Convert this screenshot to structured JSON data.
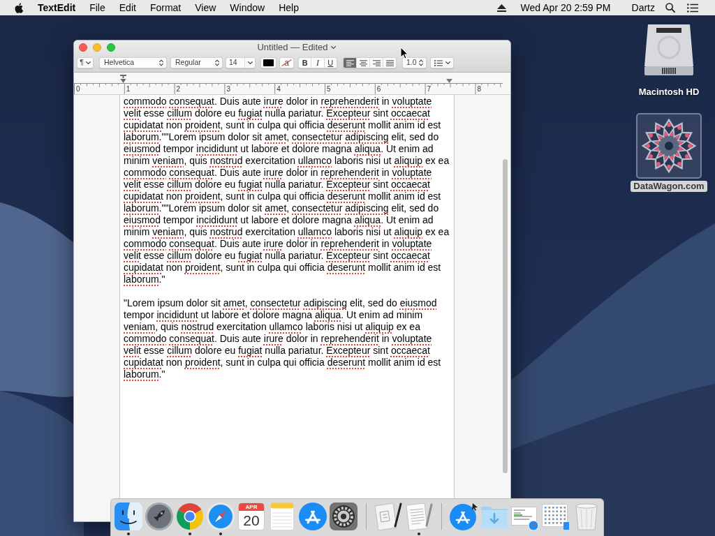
{
  "menu_bar": {
    "app_name": "TextEdit",
    "menus": [
      "File",
      "Edit",
      "Format",
      "View",
      "Window",
      "Help"
    ],
    "clock": "Wed Apr 20 2:59 PM",
    "user": "Dartz"
  },
  "window": {
    "title": "Untitled — Edited",
    "toolbar": {
      "paragraph_style": "¶",
      "font_family": "Helvetica",
      "typeface": "Regular",
      "font_size": "14",
      "background_color_glyph": "a",
      "styles": [
        {
          "kind": "bold",
          "label": "B",
          "selected": false
        },
        {
          "kind": "italic",
          "label": "I",
          "selected": false
        },
        {
          "kind": "underline",
          "label": "U",
          "selected": false
        }
      ],
      "alignments": [
        {
          "kind": "left",
          "selected": true
        },
        {
          "kind": "center",
          "selected": false
        },
        {
          "kind": "right",
          "selected": false
        },
        {
          "kind": "justify",
          "selected": false
        }
      ],
      "line_spacing": "1.0"
    },
    "ruler": {
      "labels": [
        "0",
        "1",
        "2",
        "3",
        "4",
        "5",
        "6",
        "7",
        "8"
      ]
    },
    "document": {
      "paragraphs": [
        {
          "lines": [
            [
              {
                "text": "commodo",
                "misspelled": true
              },
              {
                "text": " consequat",
                "misspelled": true
              },
              {
                "text": ". Duis aute ",
                "misspelled": false
              },
              {
                "text": "irure",
                "misspelled": true
              },
              {
                "text": " dolor in ",
                "misspelled": false
              },
              {
                "text": "reprehenderit",
                "misspelled": true
              },
              {
                "text": " in ",
                "misspelled": false
              },
              {
                "text": "voluptate",
                "misspelled": true
              }
            ],
            [
              {
                "text": "velit",
                "misspelled": true
              },
              {
                "text": " esse ",
                "misspelled": false
              },
              {
                "text": "cillum",
                "misspelled": true
              },
              {
                "text": " dolore eu ",
                "misspelled": false
              },
              {
                "text": "fugiat",
                "misspelled": true
              },
              {
                "text": " nulla pariatur. ",
                "misspelled": false
              },
              {
                "text": "Excepteur",
                "misspelled": true
              },
              {
                "text": " sint ",
                "misspelled": false
              },
              {
                "text": "occaecat",
                "misspelled": true
              }
            ],
            [
              {
                "text": "cupidatat",
                "misspelled": true
              },
              {
                "text": " non ",
                "misspelled": false
              },
              {
                "text": "proident",
                "misspelled": true
              },
              {
                "text": ", sunt in culpa qui officia ",
                "misspelled": false
              },
              {
                "text": "deserunt",
                "misspelled": true
              },
              {
                "text": " mollit anim id est",
                "misspelled": false
              }
            ],
            [
              {
                "text": "laborum",
                "misspelled": true
              },
              {
                "text": ".\"\"Lorem ipsum dolor sit ",
                "misspelled": false
              },
              {
                "text": "amet",
                "misspelled": true
              },
              {
                "text": ", ",
                "misspelled": false
              },
              {
                "text": "consectetur",
                "misspelled": true
              },
              {
                "text": " adipiscing",
                "misspelled": true
              },
              {
                "text": " elit, sed do",
                "misspelled": false
              }
            ],
            [
              {
                "text": "eiusmod",
                "misspelled": true
              },
              {
                "text": " tempor ",
                "misspelled": false
              },
              {
                "text": "incididunt",
                "misspelled": true
              },
              {
                "text": " ut labore et dolore magna ",
                "misspelled": false
              },
              {
                "text": "aliqua",
                "misspelled": true
              },
              {
                "text": ". Ut enim ad",
                "misspelled": false
              }
            ],
            [
              {
                "text": "minim ",
                "misspelled": false
              },
              {
                "text": "veniam",
                "misspelled": true
              },
              {
                "text": ", quis ",
                "misspelled": false
              },
              {
                "text": "nostrud",
                "misspelled": true
              },
              {
                "text": " exercitation ",
                "misspelled": false
              },
              {
                "text": "ullamco",
                "misspelled": true
              },
              {
                "text": " laboris nisi ut ",
                "misspelled": false
              },
              {
                "text": "aliquip",
                "misspelled": true
              },
              {
                "text": " ex ea",
                "misspelled": false
              }
            ],
            [
              {
                "text": "commodo",
                "misspelled": true
              },
              {
                "text": " consequat",
                "misspelled": true
              },
              {
                "text": ". Duis aute ",
                "misspelled": false
              },
              {
                "text": "irure",
                "misspelled": true
              },
              {
                "text": " dolor in ",
                "misspelled": false
              },
              {
                "text": "reprehenderit",
                "misspelled": true
              },
              {
                "text": " in ",
                "misspelled": false
              },
              {
                "text": "voluptate",
                "misspelled": true
              }
            ],
            [
              {
                "text": "velit",
                "misspelled": true
              },
              {
                "text": " esse ",
                "misspelled": false
              },
              {
                "text": "cillum",
                "misspelled": true
              },
              {
                "text": " dolore eu ",
                "misspelled": false
              },
              {
                "text": "fugiat",
                "misspelled": true
              },
              {
                "text": " nulla pariatur. ",
                "misspelled": false
              },
              {
                "text": "Excepteur",
                "misspelled": true
              },
              {
                "text": " sint ",
                "misspelled": false
              },
              {
                "text": "occaecat",
                "misspelled": true
              }
            ],
            [
              {
                "text": "cupidatat",
                "misspelled": true
              },
              {
                "text": " non ",
                "misspelled": false
              },
              {
                "text": "proident",
                "misspelled": true
              },
              {
                "text": ", sunt in culpa qui officia ",
                "misspelled": false
              },
              {
                "text": "deserunt",
                "misspelled": true
              },
              {
                "text": " mollit anim id est",
                "misspelled": false
              }
            ],
            [
              {
                "text": "laborum",
                "misspelled": true
              },
              {
                "text": ".\"\"Lorem ipsum dolor sit ",
                "misspelled": false
              },
              {
                "text": "amet",
                "misspelled": true
              },
              {
                "text": ", ",
                "misspelled": false
              },
              {
                "text": "consectetur",
                "misspelled": true
              },
              {
                "text": " adipiscing",
                "misspelled": true
              },
              {
                "text": " elit, sed do",
                "misspelled": false
              }
            ],
            [
              {
                "text": "eiusmod",
                "misspelled": true
              },
              {
                "text": " tempor ",
                "misspelled": false
              },
              {
                "text": "incididunt",
                "misspelled": true
              },
              {
                "text": " ut labore et dolore magna ",
                "misspelled": false
              },
              {
                "text": "aliqua",
                "misspelled": true
              },
              {
                "text": ". Ut enim ad",
                "misspelled": false
              }
            ],
            [
              {
                "text": "minim ",
                "misspelled": false
              },
              {
                "text": "veniam",
                "misspelled": true
              },
              {
                "text": ", quis ",
                "misspelled": false
              },
              {
                "text": "nostrud",
                "misspelled": true
              },
              {
                "text": " exercitation ",
                "misspelled": false
              },
              {
                "text": "ullamco",
                "misspelled": true
              },
              {
                "text": " laboris nisi ut ",
                "misspelled": false
              },
              {
                "text": "aliquip",
                "misspelled": true
              },
              {
                "text": " ex ea",
                "misspelled": false
              }
            ],
            [
              {
                "text": "commodo",
                "misspelled": true
              },
              {
                "text": " consequat",
                "misspelled": true
              },
              {
                "text": ". Duis aute ",
                "misspelled": false
              },
              {
                "text": "irure",
                "misspelled": true
              },
              {
                "text": " dolor in ",
                "misspelled": false
              },
              {
                "text": "reprehenderit",
                "misspelled": true
              },
              {
                "text": " in ",
                "misspelled": false
              },
              {
                "text": "voluptate",
                "misspelled": true
              }
            ],
            [
              {
                "text": "velit",
                "misspelled": true
              },
              {
                "text": " esse ",
                "misspelled": false
              },
              {
                "text": "cillum",
                "misspelled": true
              },
              {
                "text": " dolore eu ",
                "misspelled": false
              },
              {
                "text": "fugiat",
                "misspelled": true
              },
              {
                "text": " nulla pariatur. ",
                "misspelled": false
              },
              {
                "text": "Excepteur",
                "misspelled": true
              },
              {
                "text": " sint ",
                "misspelled": false
              },
              {
                "text": "occaecat",
                "misspelled": true
              }
            ],
            [
              {
                "text": "cupidatat",
                "misspelled": true
              },
              {
                "text": " non ",
                "misspelled": false
              },
              {
                "text": "proident",
                "misspelled": true
              },
              {
                "text": ", sunt in culpa qui officia ",
                "misspelled": false
              },
              {
                "text": "deserunt",
                "misspelled": true
              },
              {
                "text": " mollit anim id est",
                "misspelled": false
              }
            ],
            [
              {
                "text": "laborum",
                "misspelled": true
              },
              {
                "text": ".\"",
                "misspelled": false
              }
            ]
          ]
        },
        {
          "lines": [
            [
              {
                "text": "\"Lorem ipsum dolor sit ",
                "misspelled": false
              },
              {
                "text": "amet",
                "misspelled": true
              },
              {
                "text": ", ",
                "misspelled": false
              },
              {
                "text": "consectetur",
                "misspelled": true
              },
              {
                "text": " adipiscing",
                "misspelled": true
              },
              {
                "text": " elit, sed do ",
                "misspelled": false
              },
              {
                "text": "eiusmod",
                "misspelled": true
              }
            ],
            [
              {
                "text": "tempor ",
                "misspelled": false
              },
              {
                "text": "incididunt",
                "misspelled": true
              },
              {
                "text": " ut labore et dolore magna ",
                "misspelled": false
              },
              {
                "text": "aliqua",
                "misspelled": true
              },
              {
                "text": ". Ut enim ad minim",
                "misspelled": false
              }
            ],
            [
              {
                "text": "veniam",
                "misspelled": true
              },
              {
                "text": ", quis ",
                "misspelled": false
              },
              {
                "text": "nostrud",
                "misspelled": true
              },
              {
                "text": " exercitation ",
                "misspelled": false
              },
              {
                "text": "ullamco",
                "misspelled": true
              },
              {
                "text": " laboris nisi ut ",
                "misspelled": false
              },
              {
                "text": "aliquip",
                "misspelled": true
              },
              {
                "text": " ex ea",
                "misspelled": false
              }
            ],
            [
              {
                "text": "commodo",
                "misspelled": true
              },
              {
                "text": " consequat",
                "misspelled": true
              },
              {
                "text": ". Duis aute ",
                "misspelled": false
              },
              {
                "text": "irure",
                "misspelled": true
              },
              {
                "text": " dolor in ",
                "misspelled": false
              },
              {
                "text": "reprehenderit",
                "misspelled": true
              },
              {
                "text": " in ",
                "misspelled": false
              },
              {
                "text": "voluptate",
                "misspelled": true
              }
            ],
            [
              {
                "text": "velit",
                "misspelled": true
              },
              {
                "text": " esse ",
                "misspelled": false
              },
              {
                "text": "cillum",
                "misspelled": true
              },
              {
                "text": " dolore eu ",
                "misspelled": false
              },
              {
                "text": "fugiat",
                "misspelled": true
              },
              {
                "text": " nulla pariatur. ",
                "misspelled": false
              },
              {
                "text": "Excepteur",
                "misspelled": true
              },
              {
                "text": " sint ",
                "misspelled": false
              },
              {
                "text": "occaecat",
                "misspelled": true
              }
            ],
            [
              {
                "text": "cupidatat",
                "misspelled": true
              },
              {
                "text": " non ",
                "misspelled": false
              },
              {
                "text": "proident",
                "misspelled": true
              },
              {
                "text": ", sunt in culpa qui officia ",
                "misspelled": false
              },
              {
                "text": "deserunt",
                "misspelled": true
              },
              {
                "text": " mollit anim id est",
                "misspelled": false
              }
            ],
            [
              {
                "text": "laborum",
                "misspelled": true
              },
              {
                "text": ".\"",
                "misspelled": false
              }
            ]
          ]
        }
      ]
    }
  },
  "desktop_icons": [
    {
      "kind": "drive",
      "label": "Macintosh HD",
      "selected": false
    },
    {
      "kind": "image",
      "label": "DataWagon.com",
      "selected": true
    }
  ],
  "dock": {
    "sections": [
      {
        "items": [
          {
            "kind": "finder",
            "running": true
          },
          {
            "kind": "launchpad",
            "running": false
          },
          {
            "kind": "chrome",
            "running": true
          },
          {
            "kind": "safari",
            "running": true
          },
          {
            "kind": "calendar",
            "month": "APR",
            "day": "20",
            "running": false
          },
          {
            "kind": "notes",
            "running": false
          },
          {
            "kind": "app_store",
            "running": false
          },
          {
            "kind": "system_preferences",
            "running": false
          }
        ]
      },
      {
        "items": [
          {
            "kind": "script_editor",
            "running": false
          },
          {
            "kind": "textedit",
            "running": true
          }
        ]
      },
      {
        "items": [
          {
            "kind": "installer",
            "running": false
          },
          {
            "kind": "downloads",
            "running": false
          },
          {
            "kind": "screenshot",
            "running": false
          },
          {
            "kind": "window_grid",
            "running": false
          },
          {
            "kind": "trash",
            "running": false
          }
        ]
      }
    ]
  }
}
